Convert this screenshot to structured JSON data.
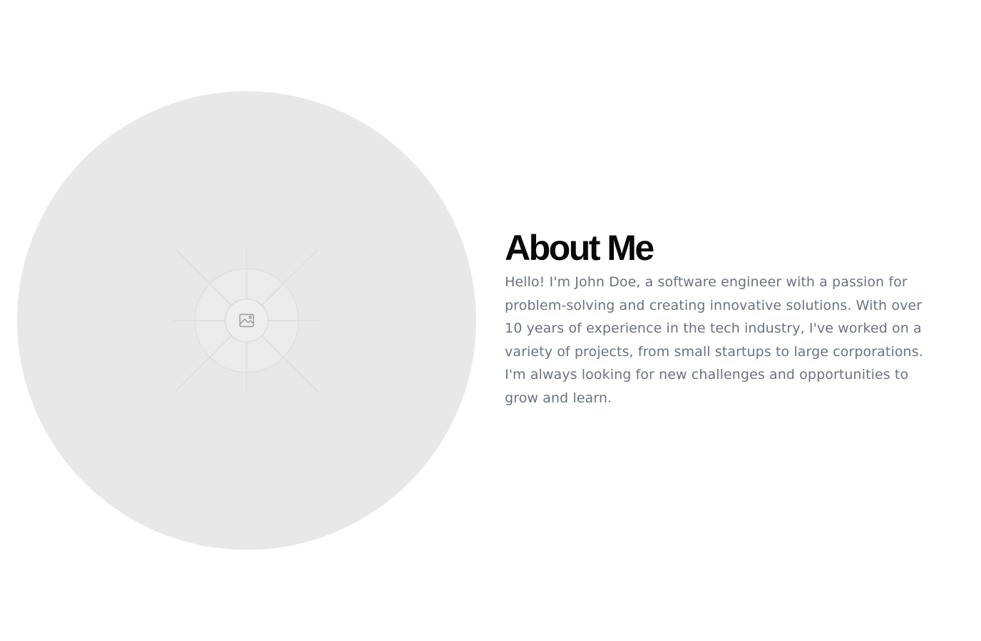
{
  "about": {
    "title": "About Me",
    "bio": "Hello! I'm John Doe, a software engineer with a passion for problem-solving and creating innovative solutions. With over 10 years of experience in the tech industry, I've worked on a variety of projects, from small startups to large corporations. I'm always looking for new challenges and opportunities to grow and learn."
  },
  "avatar": {
    "icon": "image-placeholder-icon"
  },
  "colors": {
    "background": "#ffffff",
    "placeholder": "#e8e8e8",
    "heading": "#0a0a0a",
    "body_text": "#6b7280"
  }
}
